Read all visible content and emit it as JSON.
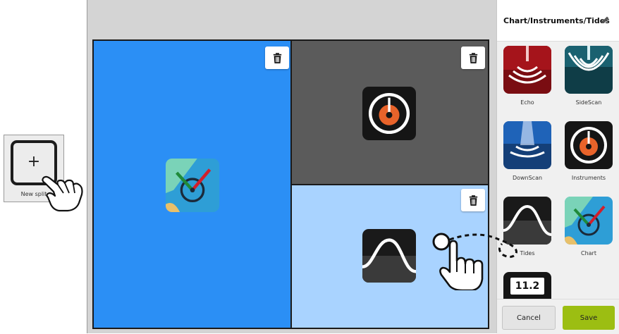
{
  "new_split": {
    "label": "New split",
    "icon": "plus-icon"
  },
  "layout_title": "Chart/Instruments/Tides",
  "panes": [
    {
      "id": "left",
      "app": "Chart",
      "color": "#2b8ff5"
    },
    {
      "id": "top-right",
      "app": "Instruments",
      "color": "#5b5b5b"
    },
    {
      "id": "bottom-right",
      "app": "Tides",
      "color": "#a9d3ff"
    }
  ],
  "apps": [
    {
      "label": "Echo",
      "icon": "echo-icon"
    },
    {
      "label": "SideScan",
      "icon": "sidescan-icon"
    },
    {
      "label": "DownScan",
      "icon": "downscan-icon"
    },
    {
      "label": "Instruments",
      "icon": "instruments-icon"
    },
    {
      "label": "Tides",
      "icon": "tides-icon"
    },
    {
      "label": "Chart",
      "icon": "chart-icon"
    },
    {
      "label": "",
      "icon": "data-icon",
      "value": "11.2"
    }
  ],
  "buttons": {
    "cancel": "Cancel",
    "save": "Save"
  },
  "colors": {
    "accent_save": "#9cbe12",
    "pane_blue": "#2b8ff5",
    "pane_gray": "#5b5b5b",
    "pane_light": "#a9d3ff"
  }
}
